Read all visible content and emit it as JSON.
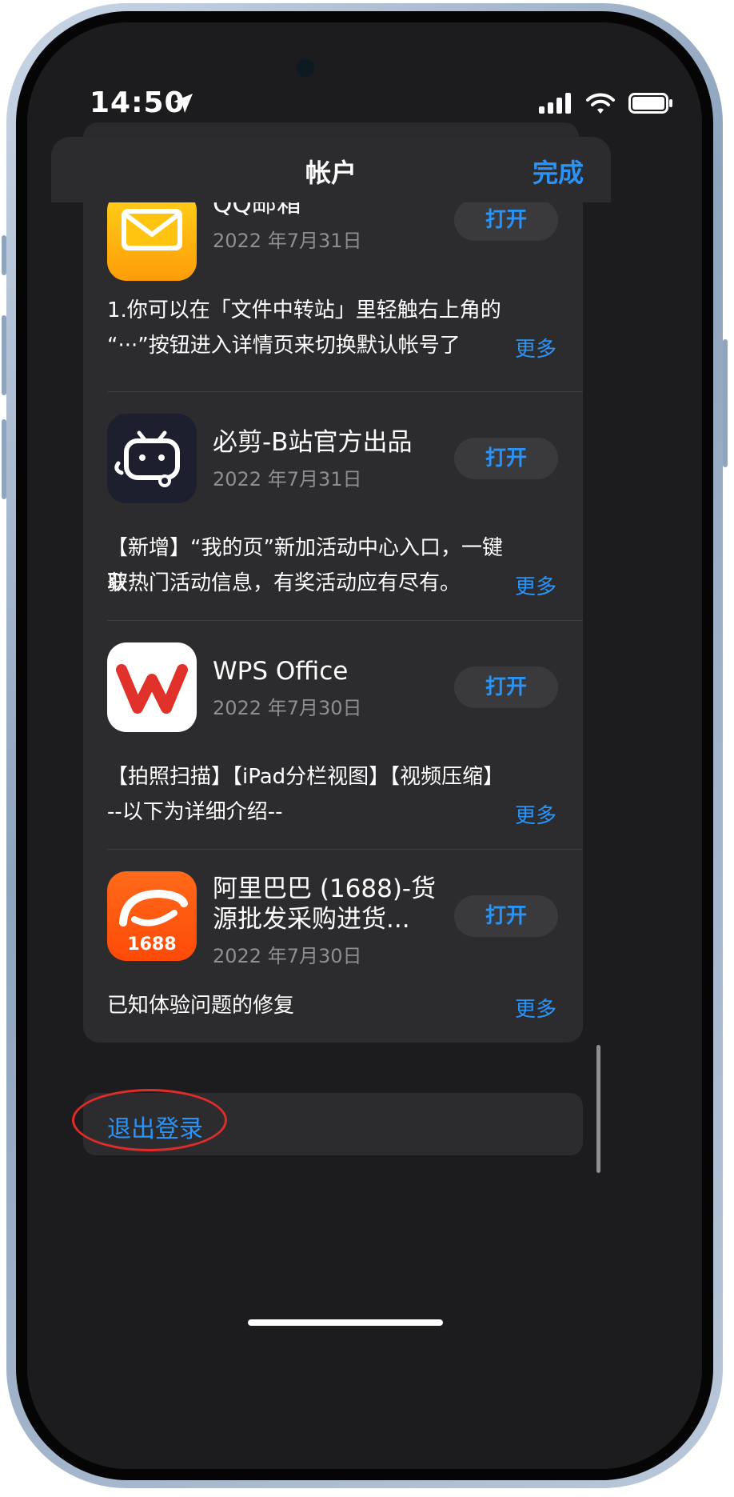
{
  "status_bar": {
    "time": "14:50"
  },
  "sheet": {
    "title": "帐户",
    "done_label": "完成"
  },
  "apps": [
    {
      "name_line1": "QQ邮箱",
      "name_line2": "",
      "date": "2022 年7月31日",
      "open_label": "打开",
      "desc_line1": "1.你可以在「文件中转站」里轻触右上角的",
      "desc_line2": "“···”按钮进入详情页来切换默认帐号了",
      "more_label": "更多"
    },
    {
      "name_line1": "必剪-B站官方出品",
      "name_line2": "",
      "date": "2022 年7月31日",
      "open_label": "打开",
      "desc_line1": "【新增】“我的页”新加活动中心入口，一键获",
      "desc_line2": "取热门活动信息，有奖活动应有尽有。",
      "more_label": "更多"
    },
    {
      "name_line1": "WPS Office",
      "name_line2": "",
      "date": "2022 年7月30日",
      "open_label": "打开",
      "desc_line1": "【拍照扫描】【iPad分栏视图】【视频压缩】",
      "desc_line2": "--以下为详细介绍--",
      "more_label": "更多"
    },
    {
      "name_line1": "阿里巴巴 (1688)-货",
      "name_line2": "源批发采购进货...",
      "date": "2022 年7月30日",
      "open_label": "打开",
      "desc_line1": "已知体验问题的修复",
      "desc_line2": "",
      "more_label": "更多",
      "icon_text": "1688"
    }
  ],
  "logout": {
    "label": "退出登录"
  },
  "colors": {
    "accent": "#2a93f5",
    "highlight": "#e02b2b"
  }
}
